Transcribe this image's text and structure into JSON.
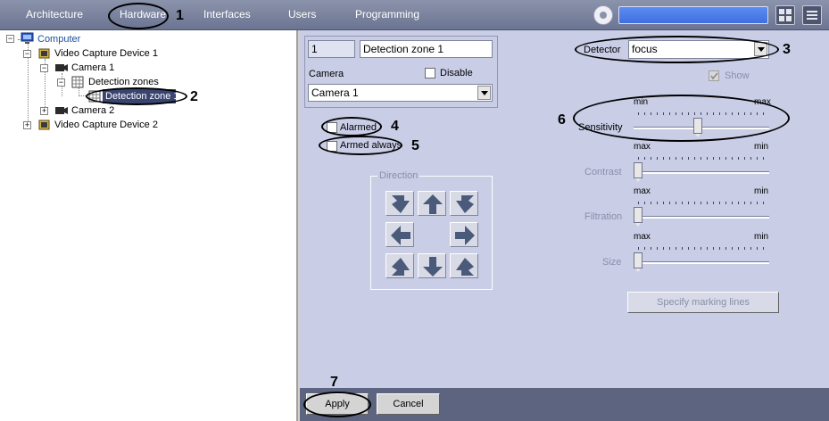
{
  "topbar": {
    "tabs": [
      "Architecture",
      "Hardware",
      "Interfaces",
      "Users",
      "Programming"
    ],
    "active_tab": "Hardware"
  },
  "tree": {
    "items": [
      {
        "label": "Computer"
      },
      {
        "label": "Video Capture Device 1"
      },
      {
        "label": "Camera 1"
      },
      {
        "label": "Detection zones"
      },
      {
        "label": "Detection zone 1",
        "selected": true
      },
      {
        "label": "Camera 2"
      },
      {
        "label": "Video Capture Device 2"
      }
    ]
  },
  "zone": {
    "id": "1",
    "name": "Detection zone 1",
    "camera_label": "Camera",
    "disable_label": "Disable",
    "disable_checked": false,
    "camera_value": "Camera 1"
  },
  "flags": {
    "alarmed_label": "Alarmed",
    "alarmed_checked": false,
    "armed_always_label": "Armed always",
    "armed_always_checked": false
  },
  "direction": {
    "title": "Direction"
  },
  "detector": {
    "label": "Detector",
    "value": "focus",
    "show_label": "Show",
    "show_checked": true
  },
  "sliders": {
    "sensitivity": {
      "label": "Sensitivity",
      "left_label": "min",
      "right_label": "max",
      "value": 0.47
    },
    "contrast": {
      "label": "Contrast",
      "left_label": "max",
      "right_label": "min",
      "value": 0.0
    },
    "filtration": {
      "label": "Filtration",
      "left_label": "max",
      "right_label": "min",
      "value": 0.0
    },
    "size": {
      "label": "Size",
      "left_label": "max",
      "right_label": "min",
      "value": 0.0
    }
  },
  "specify_label": "Specify marking lines",
  "footer": {
    "apply_label": "Apply",
    "cancel_label": "Cancel"
  },
  "callouts": [
    "1",
    "2",
    "3",
    "4",
    "5",
    "6",
    "7"
  ],
  "colors": {
    "topbar": "#6b7491",
    "panel": "#c9cde6",
    "bottombar": "#5c6480",
    "search": "#3f6fe0",
    "direction_arrow": "#4a5a7a"
  }
}
